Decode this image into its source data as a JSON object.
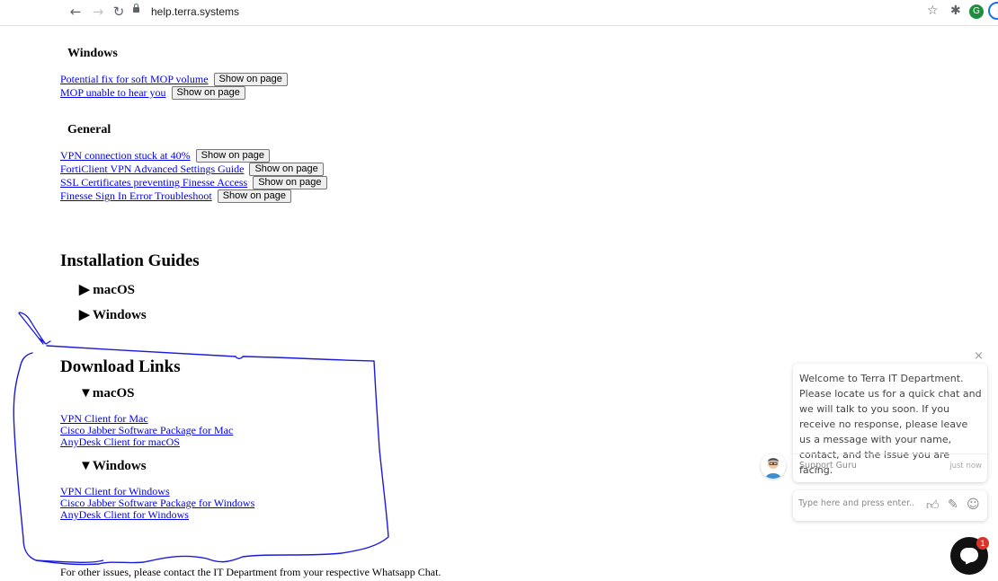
{
  "browser": {
    "back_icon": "arrow-left-icon",
    "forward_icon": "arrow-right-icon",
    "reload_icon": "reload-icon",
    "url": "help.terra.systems",
    "avatar_letter": "G",
    "avatar_color": "#1e8e3e"
  },
  "faq": {
    "sections": [
      {
        "title": "Windows",
        "items": [
          {
            "label": "Potential fix for soft MOP volume",
            "button": "Show on page"
          },
          {
            "label": "MOP unable to hear you",
            "button": "Show on page"
          }
        ]
      },
      {
        "title": "General",
        "items": [
          {
            "label": "VPN connection stuck at 40%",
            "button": "Show on page"
          },
          {
            "label": "FortiClient VPN Advanced Settings Guide",
            "button": "Show on page"
          },
          {
            "label": "SSL Certificates preventing Finesse Access",
            "button": "Show on page"
          },
          {
            "label": "Finesse Sign In Error Troubleshoot",
            "button": "Show on page"
          }
        ]
      }
    ]
  },
  "installation": {
    "title": "Installation Guides",
    "macos": "▶ macOS",
    "windows": "▶ Windows"
  },
  "downloads": {
    "title": "Download Links",
    "macos": {
      "summary": "▼macOS",
      "links": [
        "VPN Client for Mac",
        "Cisco Jabber Software Package for Mac",
        "AnyDesk Client for macOS"
      ]
    },
    "windows": {
      "summary": "▼Windows",
      "links": [
        "VPN Client for Windows",
        "Cisco Jabber Software Package for Windows",
        "AnyDesk Client for Windows"
      ]
    }
  },
  "footer": "For other issues, please contact the IT Department from your respective Whatsapp Chat.",
  "chat": {
    "message": "Welcome to Terra IT Department. Please locate us for a quick chat and we will talk to you soon. If you receive no response, please leave us a message with your name, contact, and the issue you are facing.",
    "agent_name": "Support Guru",
    "time": "just now",
    "placeholder": "Type here and press enter..",
    "badge_count": "1",
    "annotation_color": "#1a1adf"
  }
}
